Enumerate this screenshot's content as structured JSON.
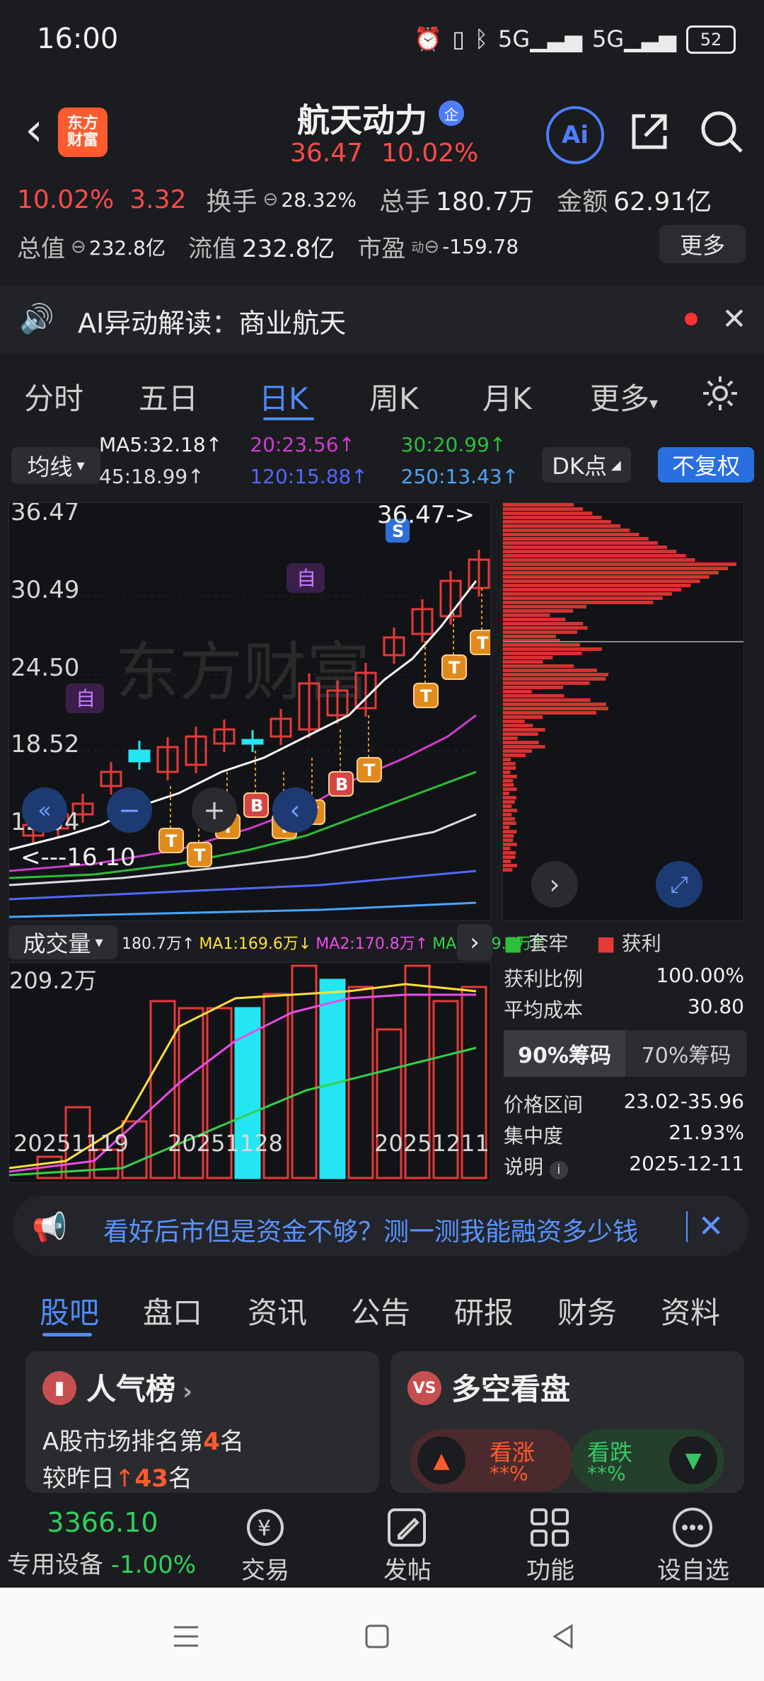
{
  "status_bar": {
    "time": "16:00",
    "battery": "52",
    "signal1": "5G",
    "signal2": "5G"
  },
  "header": {
    "app_badge_line1": "东方",
    "app_badge_line2": "财富",
    "title": "航天动力",
    "title_badge": "企",
    "price": "36.47",
    "change_pct": "10.02%",
    "ai_label": "Ai"
  },
  "stats": {
    "pct": "10.02%",
    "change": "3.32",
    "turnover_label": "换手",
    "turnover": "28.32%",
    "volume_label": "总手",
    "volume": "180.7万",
    "amount_label": "金额",
    "amount": "62.91亿",
    "total_mv_label": "总值",
    "total_mv": "232.8亿",
    "float_mv_label": "流值",
    "float_mv": "232.8亿",
    "pe_label": "市盈",
    "pe_sup": "动",
    "pe": "-159.78",
    "more": "更多"
  },
  "ai_banner": {
    "text": "AI异动解读：商业航天"
  },
  "tabs": [
    "分时",
    "五日",
    "日K",
    "周K",
    "月K",
    "更多"
  ],
  "ma_row": {
    "selector": "均线",
    "ma5": "MA5:32.18↑",
    "ma20": "20:23.56↑",
    "ma30": "30:20.99↑",
    "ma45": "45:18.99↑",
    "ma120": "120:15.88↑",
    "ma250": "250:13.43↑",
    "dk": "DK点",
    "fq": "不复权"
  },
  "kline": {
    "y_labels": [
      "36.47",
      "30.49",
      "24.50",
      "18.52",
      "12.54"
    ],
    "high_label": "36.47->",
    "low_label": "<---16.10",
    "mark_zi": "自",
    "mark_s": "S"
  },
  "chip_legend": {
    "tao": "套牢",
    "huo": "获利"
  },
  "volume_header": {
    "label": "成交量",
    "v": "180.7万↑",
    "ma1": "MA1:169.6万↓",
    "ma2": "MA2:170.8万↑",
    "ma3": "MA3:119.7万↑",
    "max": "209.2万"
  },
  "dates": [
    "20251119",
    "20251128",
    "20251211"
  ],
  "chip_info": {
    "profit_ratio_label": "获利比例",
    "profit_ratio": "100.00%",
    "avg_cost_label": "平均成本",
    "avg_cost": "30.80",
    "seg1": "90%筹码",
    "seg2": "70%筹码",
    "range_label": "价格区间",
    "range": "23.02-35.96",
    "concentration_label": "集中度",
    "concentration": "21.93%",
    "note_label": "说明",
    "note_date": "2025-12-11"
  },
  "promo": {
    "text": "看好后市但是资金不够？测一测我能融资多少钱"
  },
  "sub_tabs": [
    "股吧",
    "盘口",
    "资讯",
    "公告",
    "研报",
    "财务",
    "资料"
  ],
  "card_left": {
    "title": "人气榜",
    "line1_prefix": "A股市场排名第",
    "line1_num": "4",
    "line1_suffix": "名",
    "line2_prefix": "较昨日",
    "line2_num": "43",
    "line2_suffix": "名"
  },
  "card_right": {
    "title": "多空看盘",
    "up": "看涨",
    "down": "看跌",
    "up_val": "**%",
    "down_val": "**%"
  },
  "bottom_nav": {
    "index_value": "3366.10",
    "index_name": "专用设备",
    "index_change": "-1.00%",
    "trade": "交易",
    "post": "发帖",
    "func": "功能",
    "watch": "设自选"
  }
}
